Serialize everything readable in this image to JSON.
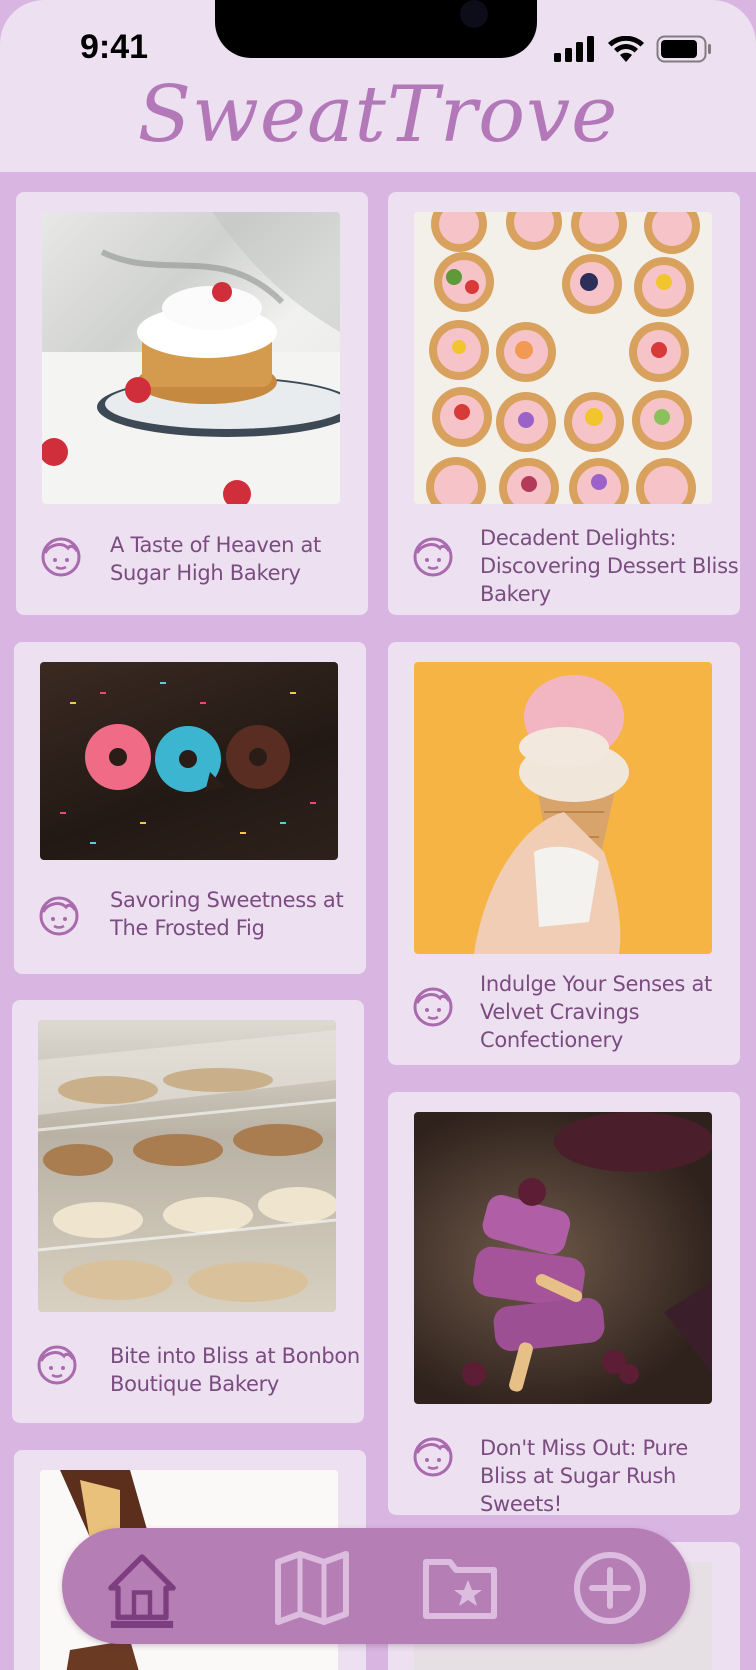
{
  "status_bar": {
    "time": "9:41",
    "signal_icon": "signal-bars-icon",
    "wifi_icon": "wifi-icon",
    "battery_icon": "battery-icon"
  },
  "app": {
    "title": "SweatTrove"
  },
  "colors": {
    "background": "#d9b5e1",
    "card": "#ede0f1",
    "accent": "#b378b8",
    "text": "#7a4c80",
    "nav": "#b57eb5",
    "nav_active": "#7d3e80",
    "nav_inactive": "#dcbde0"
  },
  "posts": [
    {
      "title": "A Taste of Heaven at Sugar High Bakery",
      "icon": "face-icon",
      "image": "waffle-photo"
    },
    {
      "title": "Decadent Delights: Discovering Dessert Bliss Bakery",
      "icon": "face-icon",
      "image": "fruit-tarts-photo"
    },
    {
      "title": "Savoring Sweetness at The Frosted Fig",
      "icon": "face-icon",
      "image": "donuts-photo"
    },
    {
      "title": "Indulge Your Senses at Velvet Cravings Confectionery",
      "icon": "face-icon",
      "image": "ice-cream-cone-photo"
    },
    {
      "title": "Bite into Bliss at Bonbon Boutique Bakery",
      "icon": "face-icon",
      "image": "pastry-case-photo"
    },
    {
      "title": "Don't Miss Out: Pure Bliss at Sugar Rush Sweets!",
      "icon": "face-icon",
      "image": "popsicles-photo"
    }
  ],
  "nav": {
    "items": [
      {
        "name": "home",
        "icon": "home-icon",
        "active": true
      },
      {
        "name": "map",
        "icon": "map-icon",
        "active": false
      },
      {
        "name": "favorites",
        "icon": "folder-star-icon",
        "active": false
      },
      {
        "name": "add",
        "icon": "plus-circle-icon",
        "active": false
      }
    ]
  }
}
